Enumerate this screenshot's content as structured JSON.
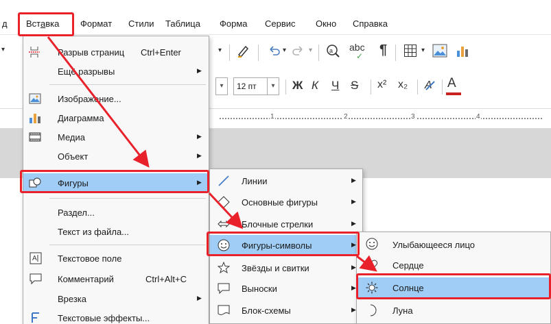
{
  "menubar": {
    "edge_item": "д",
    "insert": "Вставка",
    "format": "Формат",
    "styles": "Стили",
    "table": "Таблица",
    "form": "Форма",
    "tools": "Сервис",
    "window": "Окно",
    "help": "Справка"
  },
  "toolbar": {
    "font_size": "12 пт",
    "bold": "Ж",
    "italic": "К",
    "underline": "Ч",
    "strike": "S",
    "superscript": "x²",
    "subscript": "x₂",
    "font_color_glyph": "A",
    "abc_glyph": "abc",
    "pilcrow": "¶"
  },
  "ruler": {
    "ticks": [
      "1",
      "2",
      "3",
      "4"
    ]
  },
  "insert_menu": {
    "items": [
      {
        "label": "Разрыв страниц",
        "shortcut": "Ctrl+Enter",
        "icon": "page-break-icon"
      },
      {
        "label": "Ещё разрывы",
        "icon": ""
      },
      {
        "label": "Изображение...",
        "icon": "image-icon"
      },
      {
        "label": "Диаграмма",
        "icon": "chart-icon"
      },
      {
        "label": "Медиа",
        "icon": "media-icon"
      },
      {
        "label": "Объект",
        "icon": ""
      },
      {
        "label": "Фигуры",
        "icon": "shapes-icon"
      },
      {
        "label": "Раздел...",
        "icon": ""
      },
      {
        "label": "Текст из файла...",
        "icon": ""
      },
      {
        "label": "Текстовое поле",
        "icon": "text-box-icon"
      },
      {
        "label": "Комментарий",
        "shortcut": "Ctrl+Alt+C",
        "icon": "comment-icon"
      },
      {
        "label": "Врезка",
        "icon": ""
      },
      {
        "label": "Текстовые эффекты...",
        "icon": "fontwork-icon"
      }
    ]
  },
  "shapes_menu": {
    "items": [
      {
        "label": "Линии",
        "icon": "line-icon"
      },
      {
        "label": "Основные фигуры",
        "icon": "diamond-icon"
      },
      {
        "label": "Блочные стрелки",
        "icon": "double-arrow-icon"
      },
      {
        "label": "Фигуры-символы",
        "icon": "smiley-icon"
      },
      {
        "label": "Звёзды и свитки",
        "icon": "star-icon"
      },
      {
        "label": "Выноски",
        "icon": "callout-icon"
      },
      {
        "label": "Блок-схемы",
        "icon": "flowchart-icon"
      }
    ]
  },
  "symbols_menu": {
    "items": [
      {
        "label": "Улыбающееся лицо",
        "icon": "smiley-icon"
      },
      {
        "label": "Сердце",
        "icon": "heart-icon"
      },
      {
        "label": "Солнце",
        "icon": "sun-icon"
      },
      {
        "label": "Луна",
        "icon": "moon-icon"
      }
    ]
  },
  "colors": {
    "highlight": "#9fcdf5",
    "annotation_red": "#e8212b",
    "menu_bg": "#f8f8f8",
    "font_color_bar": "#c9211e"
  }
}
